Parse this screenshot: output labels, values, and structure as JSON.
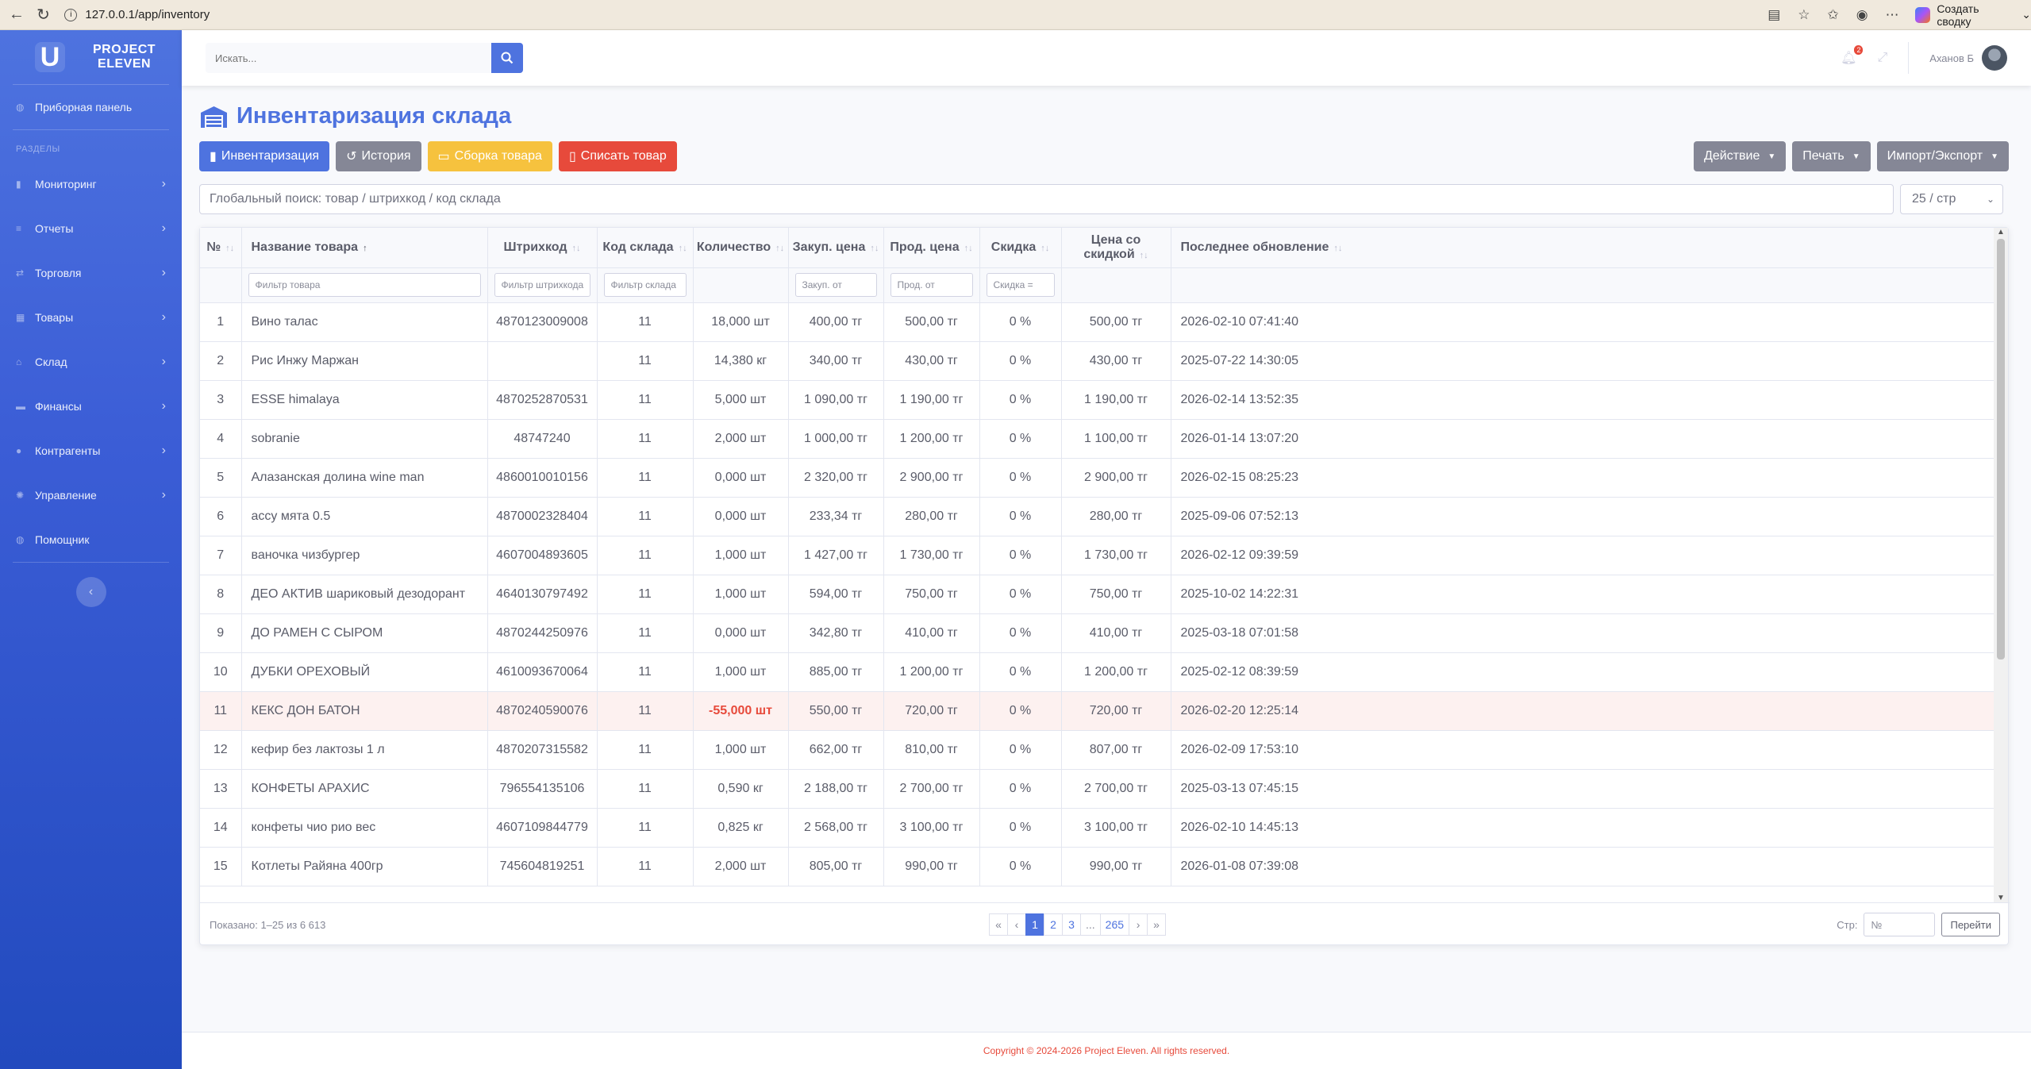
{
  "browser": {
    "url": "127.0.0.1/app/inventory",
    "ai_button": "Создать сводку"
  },
  "brand": {
    "logo_letter": "U",
    "line1": "PROJECT",
    "line2": "ELEVEN"
  },
  "sidebar": {
    "dashboard": "Приборная панель",
    "heading": "РАЗДЕЛЫ",
    "items": [
      {
        "label": "Мониторинг",
        "icon": "chart-icon"
      },
      {
        "label": "Отчеты",
        "icon": "list-icon"
      },
      {
        "label": "Торговля",
        "icon": "exchange-icon"
      },
      {
        "label": "Товары",
        "icon": "grid-icon"
      },
      {
        "label": "Склад",
        "icon": "warehouse-icon"
      },
      {
        "label": "Финансы",
        "icon": "money-icon"
      },
      {
        "label": "Контрагенты",
        "icon": "user-icon"
      },
      {
        "label": "Управление",
        "icon": "gear-icon"
      }
    ],
    "assistant": "Помощник"
  },
  "topbar": {
    "search_placeholder": "Искать...",
    "notif_count": "2",
    "user_name": "Аханов Б"
  },
  "page": {
    "title": "Инвентаризация склада",
    "buttons": {
      "inventory": "Инвентаризация",
      "history": "История",
      "assembly": "Сборка товара",
      "writeoff": "Списать товар",
      "action": "Действие",
      "print": "Печать",
      "import_export": "Импорт/Экспорт"
    },
    "global_search": "Глобальный поиск: товар / штрихкод / код склада",
    "per_page": "25 / стр"
  },
  "table": {
    "headers": [
      "№",
      "Название товара",
      "Штрихкод",
      "Код склада",
      "Количество",
      "Закуп. цена",
      "Прод. цена",
      "Скидка",
      "Цена со скидкой",
      "Последнее обновление"
    ],
    "filters": [
      "",
      "Фильтр товара",
      "Фильтр штрихкода",
      "Фильтр склада",
      "",
      "Закуп. от",
      "Прод. от",
      "Скидка =",
      "",
      ""
    ],
    "rows": [
      [
        "1",
        "Вино талас",
        "4870123009008",
        "11",
        "18,000 шт",
        "400,00 тг",
        "500,00 тг",
        "0 %",
        "500,00 тг",
        "2026-02-10 07:41:40"
      ],
      [
        "2",
        "Рис Инжу Маржан",
        "",
        "11",
        "14,380 кг",
        "340,00 тг",
        "430,00 тг",
        "0 %",
        "430,00 тг",
        "2025-07-22 14:30:05"
      ],
      [
        "3",
        "ESSE himalaya",
        "4870252870531",
        "11",
        "5,000 шт",
        "1 090,00 тг",
        "1 190,00 тг",
        "0 %",
        "1 190,00 тг",
        "2026-02-14 13:52:35"
      ],
      [
        "4",
        "sobranie",
        "48747240",
        "11",
        "2,000 шт",
        "1 000,00 тг",
        "1 200,00 тг",
        "0 %",
        "1 100,00 тг",
        "2026-01-14 13:07:20"
      ],
      [
        "5",
        "Алазанская долина wine man",
        "4860010010156",
        "11",
        "0,000 шт",
        "2 320,00 тг",
        "2 900,00 тг",
        "0 %",
        "2 900,00 тг",
        "2026-02-15 08:25:23"
      ],
      [
        "6",
        "ассу мята 0.5",
        "4870002328404",
        "11",
        "0,000 шт",
        "233,34 тг",
        "280,00 тг",
        "0 %",
        "280,00 тг",
        "2025-09-06 07:52:13"
      ],
      [
        "7",
        "ваночка чизбургер",
        "4607004893605",
        "11",
        "1,000 шт",
        "1 427,00 тг",
        "1 730,00 тг",
        "0 %",
        "1 730,00 тг",
        "2026-02-12 09:39:59"
      ],
      [
        "8",
        "ДЕО АКТИВ шариковый дезодорант",
        "4640130797492",
        "11",
        "1,000 шт",
        "594,00 тг",
        "750,00 тг",
        "0 %",
        "750,00 тг",
        "2025-10-02 14:22:31"
      ],
      [
        "9",
        "ДО РАМЕН С СЫРОМ",
        "4870244250976",
        "11",
        "0,000 шт",
        "342,80 тг",
        "410,00 тг",
        "0 %",
        "410,00 тг",
        "2025-03-18 07:01:58"
      ],
      [
        "10",
        "ДУБКИ ОРЕХОВЫЙ",
        "4610093670064",
        "11",
        "1,000 шт",
        "885,00 тг",
        "1 200,00 тг",
        "0 %",
        "1 200,00 тг",
        "2025-02-12 08:39:59"
      ],
      [
        "11",
        "КЕКС ДОН БАТОН",
        "4870240590076",
        "11",
        "-55,000 шт",
        "550,00 тг",
        "720,00 тг",
        "0 %",
        "720,00 тг",
        "2026-02-20 12:25:14"
      ],
      [
        "12",
        "кефир без лактозы 1 л",
        "4870207315582",
        "11",
        "1,000 шт",
        "662,00 тг",
        "810,00 тг",
        "0 %",
        "807,00 тг",
        "2026-02-09 17:53:10"
      ],
      [
        "13",
        "КОНФЕТЫ АРАХИС",
        "796554135106",
        "11",
        "0,590 кг",
        "2 188,00 тг",
        "2 700,00 тг",
        "0 %",
        "2 700,00 тг",
        "2025-03-13 07:45:15"
      ],
      [
        "14",
        "конфеты чио рио вес",
        "4607109844779",
        "11",
        "0,825 кг",
        "2 568,00 тг",
        "3 100,00 тг",
        "0 %",
        "3 100,00 тг",
        "2026-02-10 14:45:13"
      ],
      [
        "15",
        "Котлеты Райяна 400гр",
        "745604819251",
        "11",
        "2,000 шт",
        "805,00 тг",
        "990,00 тг",
        "0 %",
        "990,00 тг",
        "2026-01-08 07:39:08"
      ]
    ],
    "negative_row_index": 10
  },
  "footer_bar": {
    "shown": "Показано: 1–25 из 6 613",
    "pages": [
      "«",
      "‹",
      "1",
      "2",
      "3",
      "...",
      "265",
      "›",
      "»"
    ],
    "active_page": "1",
    "page_label": "Стр:",
    "page_input_placeholder": "№",
    "go_button": "Перейти"
  },
  "copyright": "Copyright © 2024-2026 Project Eleven. All rights reserved."
}
